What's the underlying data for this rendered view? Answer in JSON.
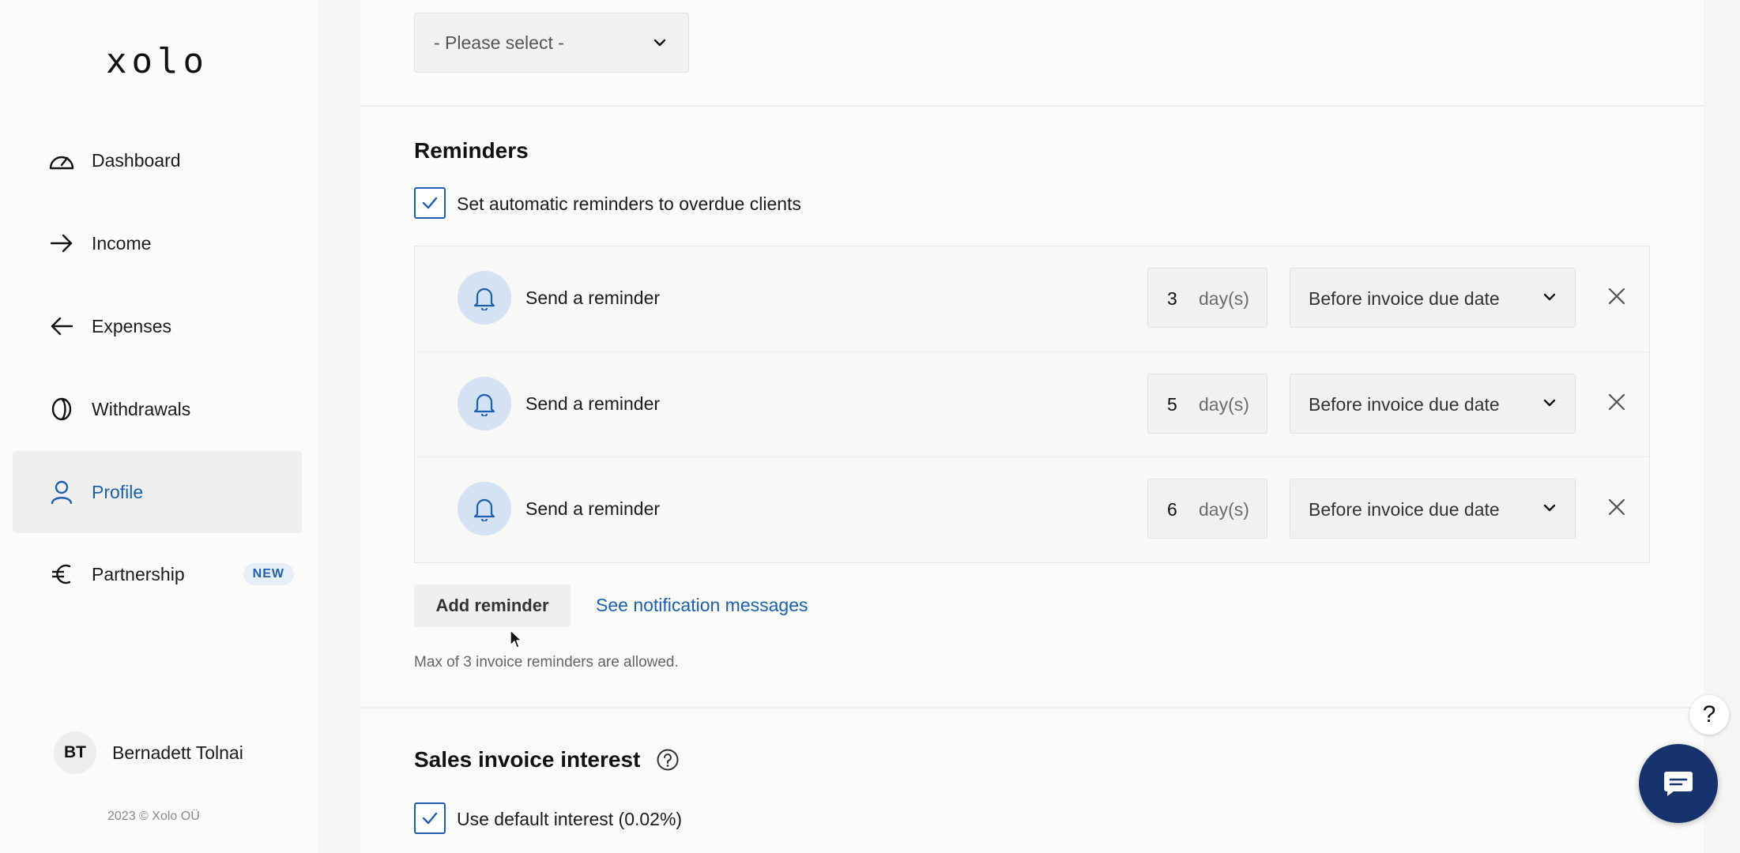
{
  "sidebar": {
    "logo": "xolo",
    "items": [
      {
        "label": "Dashboard",
        "icon": "gauge-icon"
      },
      {
        "label": "Income",
        "icon": "arrow-right-icon"
      },
      {
        "label": "Expenses",
        "icon": "arrow-left-icon"
      },
      {
        "label": "Withdrawals",
        "icon": "coin-icon"
      },
      {
        "label": "Profile",
        "icon": "user-icon",
        "active": true
      },
      {
        "label": "Partnership",
        "icon": "euro-icon",
        "badge": "NEW"
      }
    ],
    "user": {
      "initials": "BT",
      "name": "Bernadett Tolnai"
    },
    "copyright": "2023 © Xolo OÜ"
  },
  "top_select": {
    "value": "- Please select -"
  },
  "reminders": {
    "title": "Reminders",
    "auto_checkbox_label": "Set automatic reminders to overdue clients",
    "auto_checked": true,
    "rows": [
      {
        "label": "Send a reminder",
        "days": "3",
        "unit": "day(s)",
        "when": "Before invoice due date"
      },
      {
        "label": "Send a reminder",
        "days": "5",
        "unit": "day(s)",
        "when": "Before invoice due date"
      },
      {
        "label": "Send a reminder",
        "days": "6",
        "unit": "day(s)",
        "when": "Before invoice due date"
      }
    ],
    "add_button": "Add reminder",
    "notification_link": "See notification messages",
    "hint": "Max of 3 invoice reminders are allowed."
  },
  "interest": {
    "title": "Sales invoice interest",
    "default_checkbox_label": "Use default interest (0.02%)",
    "default_checked": true
  },
  "help": {
    "label": "?"
  },
  "colors": {
    "accent": "#1d5fb0",
    "chat": "#16336e",
    "bell_bg": "#d4e2f3"
  }
}
